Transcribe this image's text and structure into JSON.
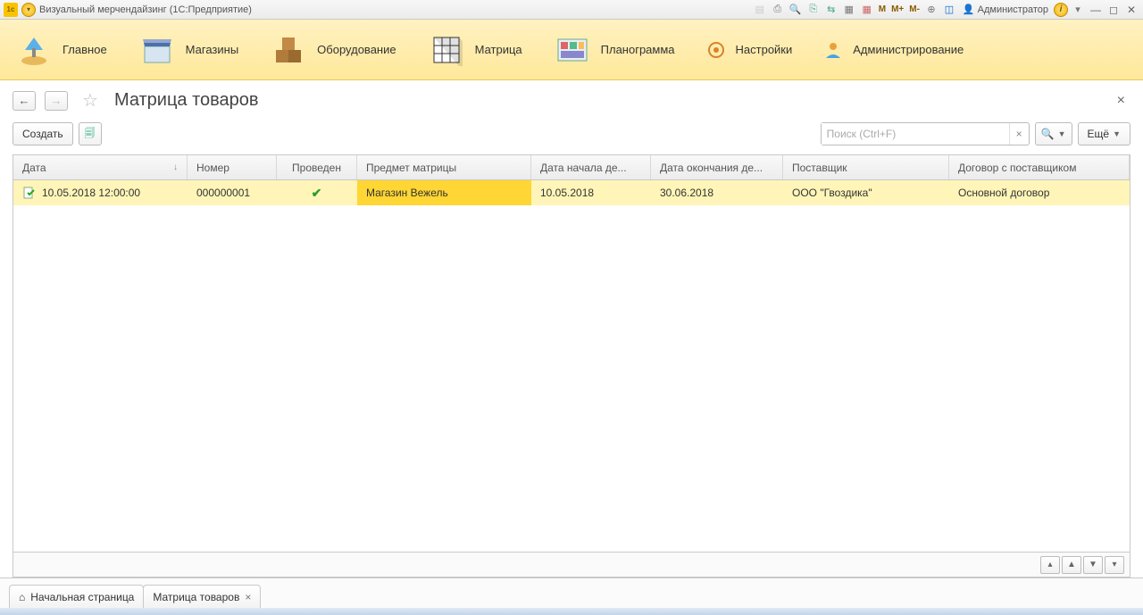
{
  "titlebar": {
    "app_title": "Визуальный мерчендайзинг  (1С:Предприятие)",
    "user_label": "Администратор",
    "m": "M",
    "mplus": "M+",
    "mminus": "M-"
  },
  "sections": {
    "main": "Главное",
    "shops": "Магазины",
    "equipment": "Оборудование",
    "matrix": "Матрица",
    "planogram": "Планограмма",
    "settings": "Настройки",
    "admin": "Администрирование"
  },
  "page": {
    "title": "Матрица товаров"
  },
  "cmd": {
    "create": "Создать",
    "search_placeholder": "Поиск (Ctrl+F)",
    "more": "Ещё"
  },
  "columns": {
    "date": "Дата",
    "number": "Номер",
    "posted": "Проведен",
    "subject": "Предмет матрицы",
    "start": "Дата начала де...",
    "end": "Дата окончания де...",
    "supplier": "Поставщик",
    "contract": "Договор с поставщиком"
  },
  "rows": [
    {
      "date": "10.05.2018 12:00:00",
      "number": "000000001",
      "posted": true,
      "subject": "Магазин Вежель",
      "start": "10.05.2018",
      "end": "30.06.2018",
      "supplier": "ООО \"Гвоздика\"",
      "contract": "Основной договор"
    }
  ],
  "tabs": {
    "home": "Начальная страница",
    "matrix": "Матрица товаров"
  }
}
